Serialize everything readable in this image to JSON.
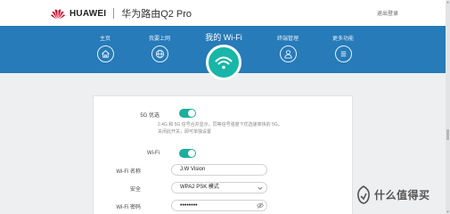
{
  "header": {
    "brand": "HUAWEI",
    "product": "华为路由Q2 Pro",
    "logout": "退出登录",
    "logo_color": "#cf0a2c"
  },
  "nav": {
    "active_title": "我的 Wi-Fi",
    "items": [
      {
        "label": "主页",
        "icon": "home-icon"
      },
      {
        "label": "我要上网",
        "icon": "globe-icon"
      },
      {
        "label": "终端管理",
        "icon": "user-icon"
      },
      {
        "label": "更多功能",
        "icon": "menu-icon"
      }
    ],
    "colors": {
      "bar": "#267bb8",
      "active": "#18b6a8"
    }
  },
  "settings": {
    "band_merge": {
      "label": "5G 优选",
      "on": true,
      "description": "2.4G 和 5G 信号合并显示，同等信号强度下优选速率快的 5G。关闭此开关，即可单独设置"
    },
    "wifi": {
      "label": "Wi-Fi",
      "on": true
    },
    "ssid": {
      "label": "Wi-Fi 名称",
      "value": "J.W Vision"
    },
    "security": {
      "label": "安全",
      "value": "WPA2 PSK 模式"
    },
    "password": {
      "label": "Wi-Fi 密码",
      "value": "••••••••"
    }
  },
  "watermark": {
    "text": "什么值得买"
  }
}
